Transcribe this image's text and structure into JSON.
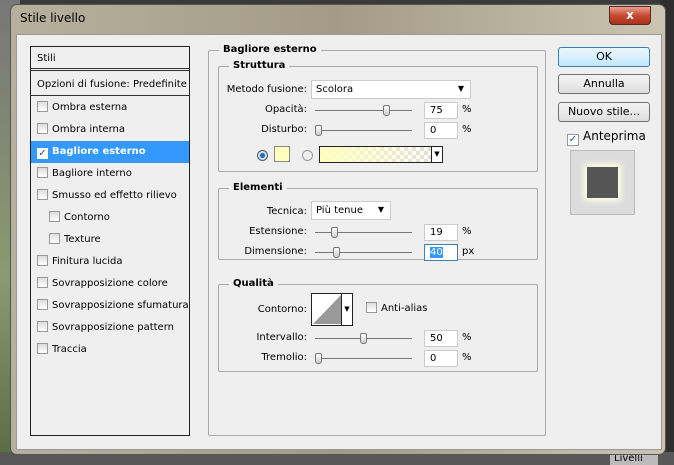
{
  "window": {
    "title": "Stile livello",
    "close_label": "x"
  },
  "background": {
    "panel_tab": "Livelli"
  },
  "styles": {
    "header": "Stili",
    "blend_options": "Opzioni di fusione: Predefinite",
    "items": [
      {
        "label": "Ombra esterna",
        "checked": false,
        "indent": false
      },
      {
        "label": "Ombra interna",
        "checked": false,
        "indent": false
      },
      {
        "label": "Bagliore esterno",
        "checked": true,
        "indent": false,
        "selected": true
      },
      {
        "label": "Bagliore interno",
        "checked": false,
        "indent": false
      },
      {
        "label": "Smusso ed effetto rilievo",
        "checked": false,
        "indent": false
      },
      {
        "label": "Contorno",
        "checked": false,
        "indent": true
      },
      {
        "label": "Texture",
        "checked": false,
        "indent": true
      },
      {
        "label": "Finitura lucida",
        "checked": false,
        "indent": false
      },
      {
        "label": "Sovrapposizione colore",
        "checked": false,
        "indent": false
      },
      {
        "label": "Sovrapposizione sfumatura",
        "checked": false,
        "indent": false
      },
      {
        "label": "Sovrapposizione pattern",
        "checked": false,
        "indent": false
      },
      {
        "label": "Traccia",
        "checked": false,
        "indent": false
      }
    ]
  },
  "panel": {
    "title": "Bagliore esterno",
    "structure": {
      "title": "Struttura",
      "blend_label": "Metodo fusione:",
      "blend_value": "Scolora",
      "opacity_label": "Opacità:",
      "opacity_value": "75",
      "opacity_unit": "%",
      "noise_label": "Disturbo:",
      "noise_value": "0",
      "noise_unit": "%",
      "color": "#ffffc0",
      "color_mode": "solid"
    },
    "elements": {
      "title": "Elementi",
      "technique_label": "Tecnica:",
      "technique_value": "Più tenue",
      "spread_label": "Estensione:",
      "spread_value": "19",
      "spread_unit": "%",
      "size_label": "Dimensione:",
      "size_value": "40",
      "size_unit": "px"
    },
    "quality": {
      "title": "Qualità",
      "contour_label": "Contorno:",
      "antialias_label": "Anti-alias",
      "antialias_checked": false,
      "range_label": "Intervallo:",
      "range_value": "50",
      "range_unit": "%",
      "jitter_label": "Tremolio:",
      "jitter_value": "0",
      "jitter_unit": "%"
    }
  },
  "buttons": {
    "ok": "OK",
    "cancel": "Annulla",
    "new_style": "Nuovo stile...",
    "preview_label": "Anteprima",
    "preview_checked": true
  },
  "colors": {
    "selection": "#3399ff",
    "glow": "#ffffc0"
  }
}
